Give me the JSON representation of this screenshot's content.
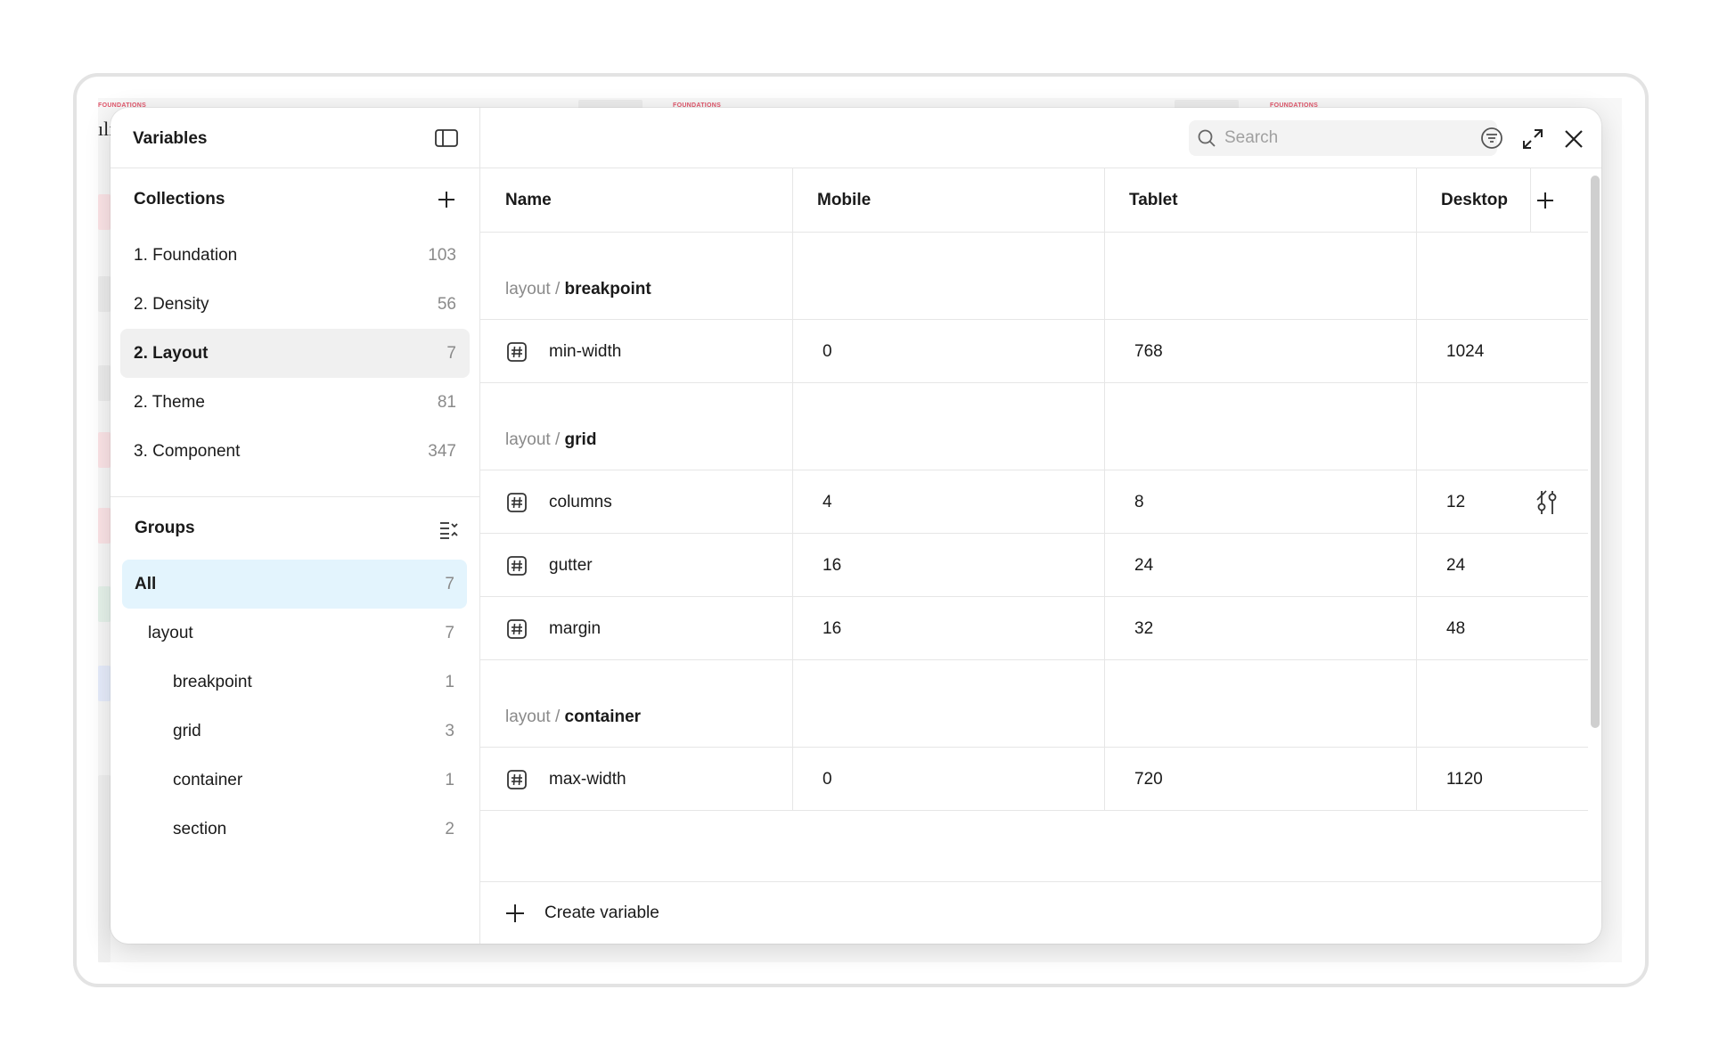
{
  "background_canvas": {
    "tiny_labels": [
      "FOUNDATIONS",
      "FOUNDATIONS",
      "FOUNDATIONS"
    ],
    "accent_color": "#e0556a"
  },
  "left_panel": {
    "title": "Variables",
    "toggle_icon": "sidebar-icon",
    "collections": {
      "title": "Collections",
      "add_icon": "plus-icon",
      "items": [
        {
          "label": "1. Foundation",
          "count": "103",
          "active": false
        },
        {
          "label": "2. Density",
          "count": "56",
          "active": false
        },
        {
          "label": "2. Layout",
          "count": "7",
          "active": true
        },
        {
          "label": "2. Theme",
          "count": "81",
          "active": false
        },
        {
          "label": "3. Component",
          "count": "347",
          "active": false
        }
      ]
    },
    "groups": {
      "title": "Groups",
      "collapse_icon": "collapse-list-icon",
      "items": [
        {
          "label": "All",
          "count": "7",
          "level": 0,
          "active": true
        },
        {
          "label": "layout",
          "count": "7",
          "level": 1,
          "active": false
        },
        {
          "label": "breakpoint",
          "count": "1",
          "level": 2,
          "active": false
        },
        {
          "label": "grid",
          "count": "3",
          "level": 2,
          "active": false
        },
        {
          "label": "container",
          "count": "1",
          "level": 2,
          "active": false
        },
        {
          "label": "section",
          "count": "2",
          "level": 2,
          "active": false
        }
      ]
    }
  },
  "toolbar": {
    "search_placeholder": "Search",
    "search_value": "",
    "icons": [
      "search-icon",
      "filter-icon",
      "expand-icon",
      "close-icon"
    ]
  },
  "table": {
    "columns": [
      "Name",
      "Mobile",
      "Tablet",
      "Desktop"
    ],
    "add_column_icon": "plus-icon",
    "groups": [
      {
        "prefix": "layout / ",
        "name": "breakpoint",
        "rows": [
          {
            "name": "min-width",
            "type_icon": "number-icon",
            "values": [
              "0",
              "768",
              "1024"
            ]
          }
        ]
      },
      {
        "prefix": "layout / ",
        "name": "grid",
        "rows": [
          {
            "name": "columns",
            "type_icon": "number-icon",
            "values": [
              "4",
              "8",
              "12"
            ],
            "tool_icon": "sliders-icon"
          },
          {
            "name": "gutter",
            "type_icon": "number-icon",
            "values": [
              "16",
              "24",
              "24"
            ]
          },
          {
            "name": "margin",
            "type_icon": "number-icon",
            "values": [
              "16",
              "32",
              "48"
            ]
          }
        ]
      },
      {
        "prefix": "layout / ",
        "name": "container",
        "rows": [
          {
            "name": "max-width",
            "type_icon": "number-icon",
            "values": [
              "0",
              "720",
              "1120"
            ]
          }
        ]
      }
    ]
  },
  "footer": {
    "create_label": "Create variable",
    "icon": "plus-icon"
  },
  "colors": {
    "active_collection_bg": "#f0f0f0",
    "active_group_bg": "#e3f4fd",
    "border": "#e6e6e6",
    "muted_text": "#8a8a8a"
  }
}
